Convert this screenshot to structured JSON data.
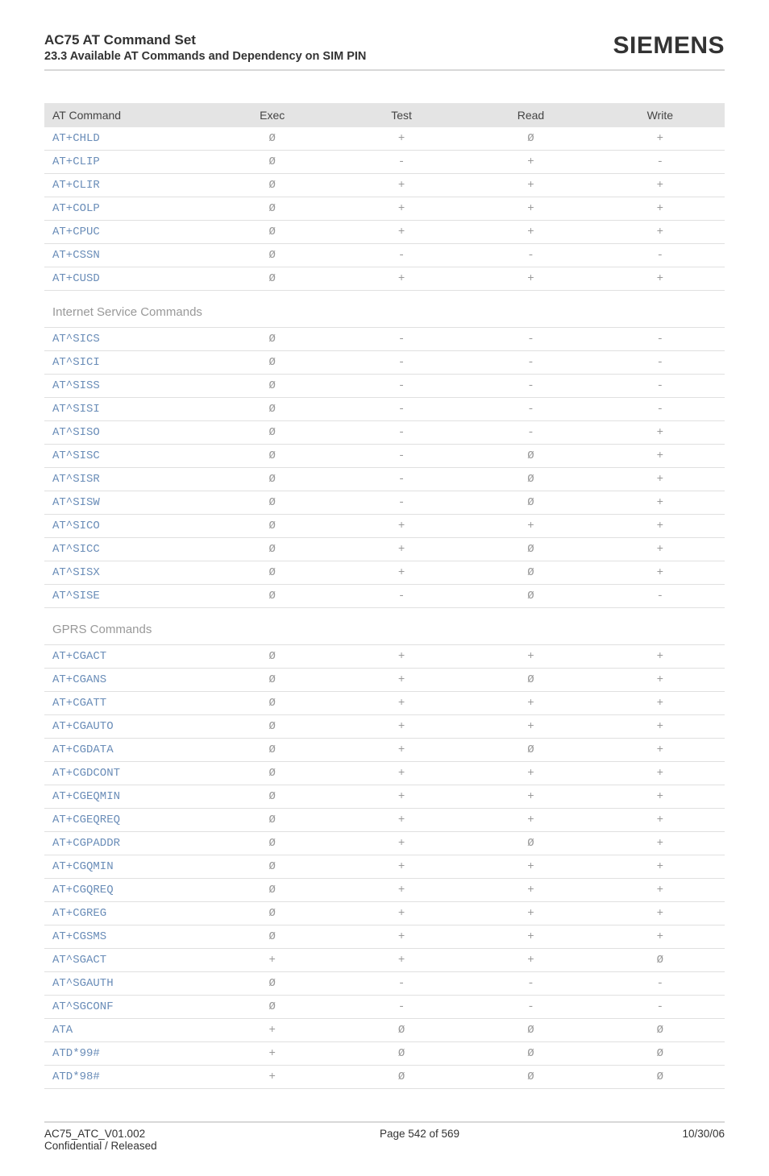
{
  "header": {
    "title": "AC75 AT Command Set",
    "subtitle": "23.3 Available AT Commands and Dependency on SIM PIN",
    "brand": "SIEMENS"
  },
  "columns": [
    "AT Command",
    "Exec",
    "Test",
    "Read",
    "Write"
  ],
  "symbols": {
    "plus": "+",
    "dash": "-",
    "empty": "Ø"
  },
  "sections": [
    {
      "title": null,
      "rows": [
        {
          "cmd": "AT+CHLD",
          "exec": "Ø",
          "test": "+",
          "read": "Ø",
          "write": "+"
        },
        {
          "cmd": "AT+CLIP",
          "exec": "Ø",
          "test": "-",
          "read": "+",
          "write": "-"
        },
        {
          "cmd": "AT+CLIR",
          "exec": "Ø",
          "test": "+",
          "read": "+",
          "write": "+"
        },
        {
          "cmd": "AT+COLP",
          "exec": "Ø",
          "test": "+",
          "read": "+",
          "write": "+"
        },
        {
          "cmd": "AT+CPUC",
          "exec": "Ø",
          "test": "+",
          "read": "+",
          "write": "+"
        },
        {
          "cmd": "AT+CSSN",
          "exec": "Ø",
          "test": "-",
          "read": "-",
          "write": "-"
        },
        {
          "cmd": "AT+CUSD",
          "exec": "Ø",
          "test": "+",
          "read": "+",
          "write": "+"
        }
      ]
    },
    {
      "title": "Internet Service Commands",
      "rows": [
        {
          "cmd": "AT^SICS",
          "exec": "Ø",
          "test": "-",
          "read": "-",
          "write": "-"
        },
        {
          "cmd": "AT^SICI",
          "exec": "Ø",
          "test": "-",
          "read": "-",
          "write": "-"
        },
        {
          "cmd": "AT^SISS",
          "exec": "Ø",
          "test": "-",
          "read": "-",
          "write": "-"
        },
        {
          "cmd": "AT^SISI",
          "exec": "Ø",
          "test": "-",
          "read": "-",
          "write": "-"
        },
        {
          "cmd": "AT^SISO",
          "exec": "Ø",
          "test": "-",
          "read": "-",
          "write": "+"
        },
        {
          "cmd": "AT^SISC",
          "exec": "Ø",
          "test": "-",
          "read": "Ø",
          "write": "+"
        },
        {
          "cmd": "AT^SISR",
          "exec": "Ø",
          "test": "-",
          "read": "Ø",
          "write": "+"
        },
        {
          "cmd": "AT^SISW",
          "exec": "Ø",
          "test": "-",
          "read": "Ø",
          "write": "+"
        },
        {
          "cmd": "AT^SICO",
          "exec": "Ø",
          "test": "+",
          "read": "+",
          "write": "+"
        },
        {
          "cmd": "AT^SICC",
          "exec": "Ø",
          "test": "+",
          "read": "Ø",
          "write": "+"
        },
        {
          "cmd": "AT^SISX",
          "exec": "Ø",
          "test": "+",
          "read": "Ø",
          "write": "+"
        },
        {
          "cmd": "AT^SISE",
          "exec": "Ø",
          "test": "-",
          "read": "Ø",
          "write": "-"
        }
      ]
    },
    {
      "title": "GPRS Commands",
      "rows": [
        {
          "cmd": "AT+CGACT",
          "exec": "Ø",
          "test": "+",
          "read": "+",
          "write": "+"
        },
        {
          "cmd": "AT+CGANS",
          "exec": "Ø",
          "test": "+",
          "read": "Ø",
          "write": "+"
        },
        {
          "cmd": "AT+CGATT",
          "exec": "Ø",
          "test": "+",
          "read": "+",
          "write": "+"
        },
        {
          "cmd": "AT+CGAUTO",
          "exec": "Ø",
          "test": "+",
          "read": "+",
          "write": "+"
        },
        {
          "cmd": "AT+CGDATA",
          "exec": "Ø",
          "test": "+",
          "read": "Ø",
          "write": "+"
        },
        {
          "cmd": "AT+CGDCONT",
          "exec": "Ø",
          "test": "+",
          "read": "+",
          "write": "+"
        },
        {
          "cmd": "AT+CGEQMIN",
          "exec": "Ø",
          "test": "+",
          "read": "+",
          "write": "+"
        },
        {
          "cmd": "AT+CGEQREQ",
          "exec": "Ø",
          "test": "+",
          "read": "+",
          "write": "+"
        },
        {
          "cmd": "AT+CGPADDR",
          "exec": "Ø",
          "test": "+",
          "read": "Ø",
          "write": "+"
        },
        {
          "cmd": "AT+CGQMIN",
          "exec": "Ø",
          "test": "+",
          "read": "+",
          "write": "+"
        },
        {
          "cmd": "AT+CGQREQ",
          "exec": "Ø",
          "test": "+",
          "read": "+",
          "write": "+"
        },
        {
          "cmd": "AT+CGREG",
          "exec": "Ø",
          "test": "+",
          "read": "+",
          "write": "+"
        },
        {
          "cmd": "AT+CGSMS",
          "exec": "Ø",
          "test": "+",
          "read": "+",
          "write": "+"
        },
        {
          "cmd": "AT^SGACT",
          "exec": "+",
          "test": "+",
          "read": "+",
          "write": "Ø"
        },
        {
          "cmd": "AT^SGAUTH",
          "exec": "Ø",
          "test": "-",
          "read": "-",
          "write": "-"
        },
        {
          "cmd": "AT^SGCONF",
          "exec": "Ø",
          "test": "-",
          "read": "-",
          "write": "-"
        },
        {
          "cmd": "ATA",
          "exec": "+",
          "test": "Ø",
          "read": "Ø",
          "write": "Ø"
        },
        {
          "cmd": "ATD*99#",
          "exec": "+",
          "test": "Ø",
          "read": "Ø",
          "write": "Ø"
        },
        {
          "cmd": "ATD*98#",
          "exec": "+",
          "test": "Ø",
          "read": "Ø",
          "write": "Ø"
        }
      ]
    }
  ],
  "footer": {
    "left1": "AC75_ATC_V01.002",
    "left2": "Confidential / Released",
    "center": "Page 542 of 569",
    "right": "10/30/06"
  }
}
